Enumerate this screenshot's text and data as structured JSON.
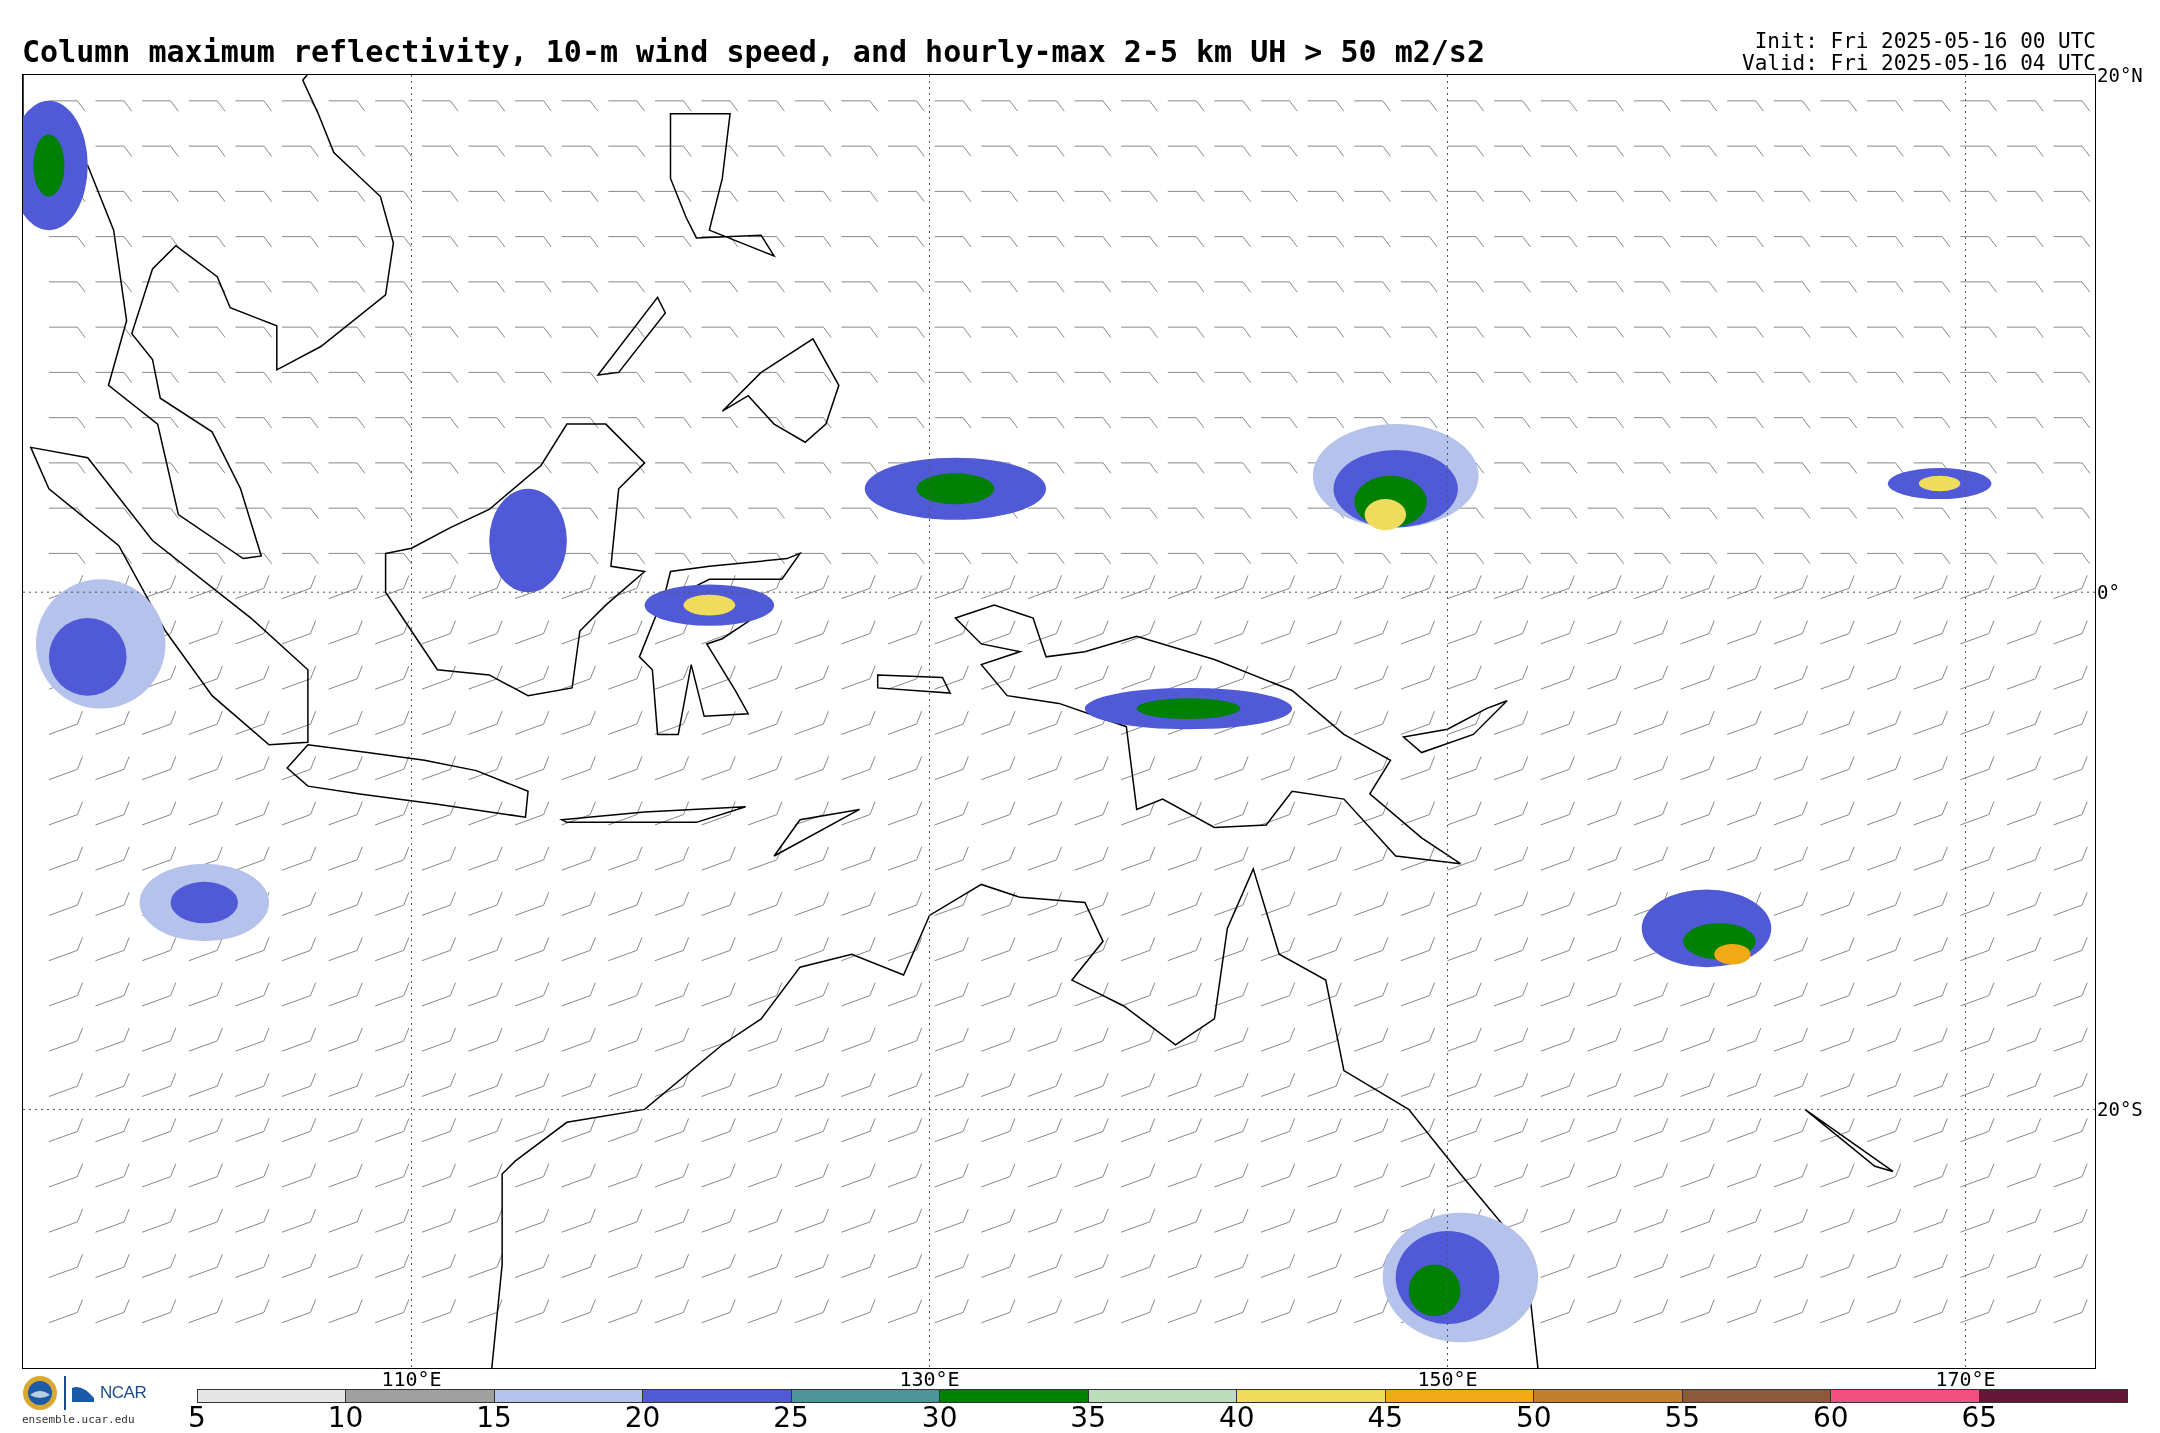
{
  "title": "Column maximum reflectivity, 10-m wind speed, and hourly-max 2-5 km UH > 50 m2/s2",
  "init": "Init: Fri 2025-05-16 00 UTC",
  "valid": "Valid: Fri 2025-05-16 04 UTC",
  "map": {
    "lat_labels": [
      "20°N",
      "0°",
      "20°S"
    ],
    "lon_labels": [
      "110°E",
      "130°E",
      "150°E",
      "170°E"
    ]
  },
  "credit": {
    "org": "NCAR",
    "url": "ensemble.ucar.edu"
  },
  "colorbar": {
    "segments": [
      {
        "label": "5",
        "color": "#e6e6e6"
      },
      {
        "label": "10",
        "color": "#a0a0a0"
      },
      {
        "label": "15",
        "color": "#b4c2ec"
      },
      {
        "label": "20",
        "color": "#505ad6"
      },
      {
        "label": "25",
        "color": "#4e9598"
      },
      {
        "label": "30",
        "color": "#008000"
      },
      {
        "label": "35",
        "color": "#bcdcbc"
      },
      {
        "label": "40",
        "color": "#f0dc5c"
      },
      {
        "label": "45",
        "color": "#f0aa18"
      },
      {
        "label": "50",
        "color": "#c08030"
      },
      {
        "label": "55",
        "color": "#8b5a3c"
      },
      {
        "label": "60",
        "color": "#f25080"
      },
      {
        "label": "65",
        "color": "#641838"
      }
    ]
  }
}
